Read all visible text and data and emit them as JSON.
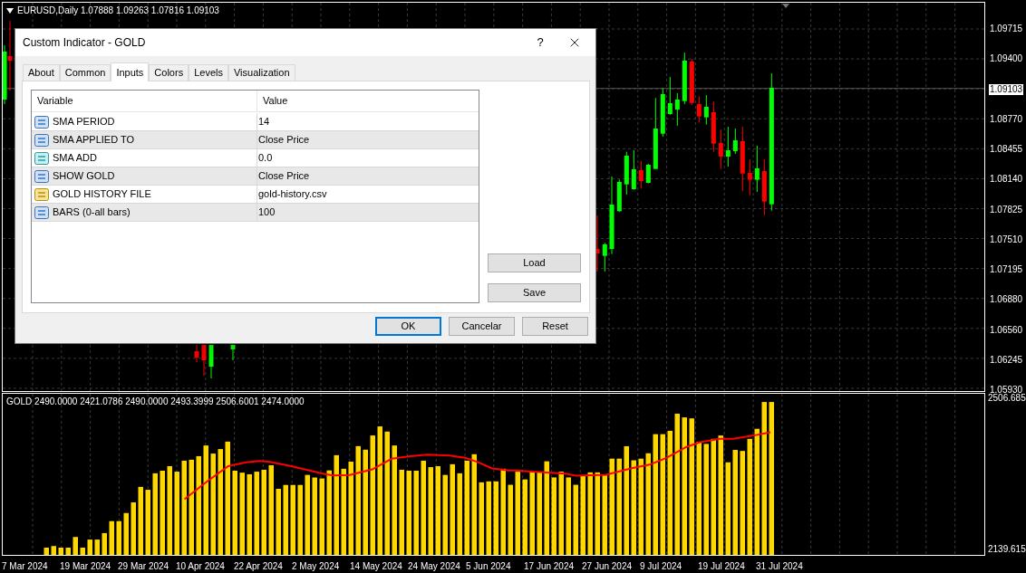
{
  "chart": {
    "header": "EURUSD,Daily 1.07888 1.09263 1.07816 1.09103",
    "price_axis": [
      {
        "text": "1.09715",
        "current": false
      },
      {
        "text": "1.09400",
        "current": false
      },
      {
        "text": "1.09103",
        "current": true
      },
      {
        "text": "1.08770",
        "current": false
      },
      {
        "text": "1.08455",
        "current": false
      },
      {
        "text": "1.08140",
        "current": false
      },
      {
        "text": "1.07825",
        "current": false
      },
      {
        "text": "1.07510",
        "current": false
      },
      {
        "text": "1.07195",
        "current": false
      },
      {
        "text": "1.06880",
        "current": false
      },
      {
        "text": "1.06560",
        "current": false
      },
      {
        "text": "1.06245",
        "current": false
      },
      {
        "text": "1.05930",
        "current": false
      }
    ]
  },
  "indicator": {
    "header": "GOLD 2490.0000 2421.0786 2490.0000 2493.3999 2506.6001 2474.0000",
    "axis": [
      "2506.685",
      "2139.615"
    ]
  },
  "time_axis": [
    "7 Mar 2024",
    "19 Mar 2024",
    "29 Mar 2024",
    "10 Apr 2024",
    "22 Apr 2024",
    "2 May 2024",
    "14 May 2024",
    "24 May 2024",
    "5 Jun 2024",
    "17 Jun 2024",
    "27 Jun 2024",
    "9 Jul 2024",
    "19 Jul 2024",
    "31 Jul 2024"
  ],
  "dialog": {
    "title": "Custom Indicator - GOLD",
    "help": "?",
    "tabs": [
      {
        "label": "About",
        "selected": false
      },
      {
        "label": "Common",
        "selected": false
      },
      {
        "label": "Inputs",
        "selected": true
      },
      {
        "label": "Colors",
        "selected": false
      },
      {
        "label": "Levels",
        "selected": false
      },
      {
        "label": "Visualization",
        "selected": false
      }
    ],
    "table": {
      "columns": [
        "Variable",
        "Value"
      ],
      "rows": [
        {
          "kind": "int",
          "variable": "SMA PERIOD",
          "value": "14"
        },
        {
          "kind": "int",
          "variable": "SMA APPLIED TO",
          "value": "Close Price"
        },
        {
          "kind": "double",
          "variable": "SMA ADD",
          "value": "0.0"
        },
        {
          "kind": "int",
          "variable": "SHOW GOLD",
          "value": "Close Price"
        },
        {
          "kind": "string",
          "variable": "GOLD HISTORY FILE",
          "value": "gold-history.csv"
        },
        {
          "kind": "int",
          "variable": "BARS (0-all bars)",
          "value": "100"
        }
      ]
    },
    "side_buttons": [
      "Load",
      "Save"
    ],
    "buttons": [
      {
        "label": "OK",
        "default": true
      },
      {
        "label": "Cancelar",
        "default": false
      },
      {
        "label": "Reset",
        "default": false
      }
    ]
  }
}
